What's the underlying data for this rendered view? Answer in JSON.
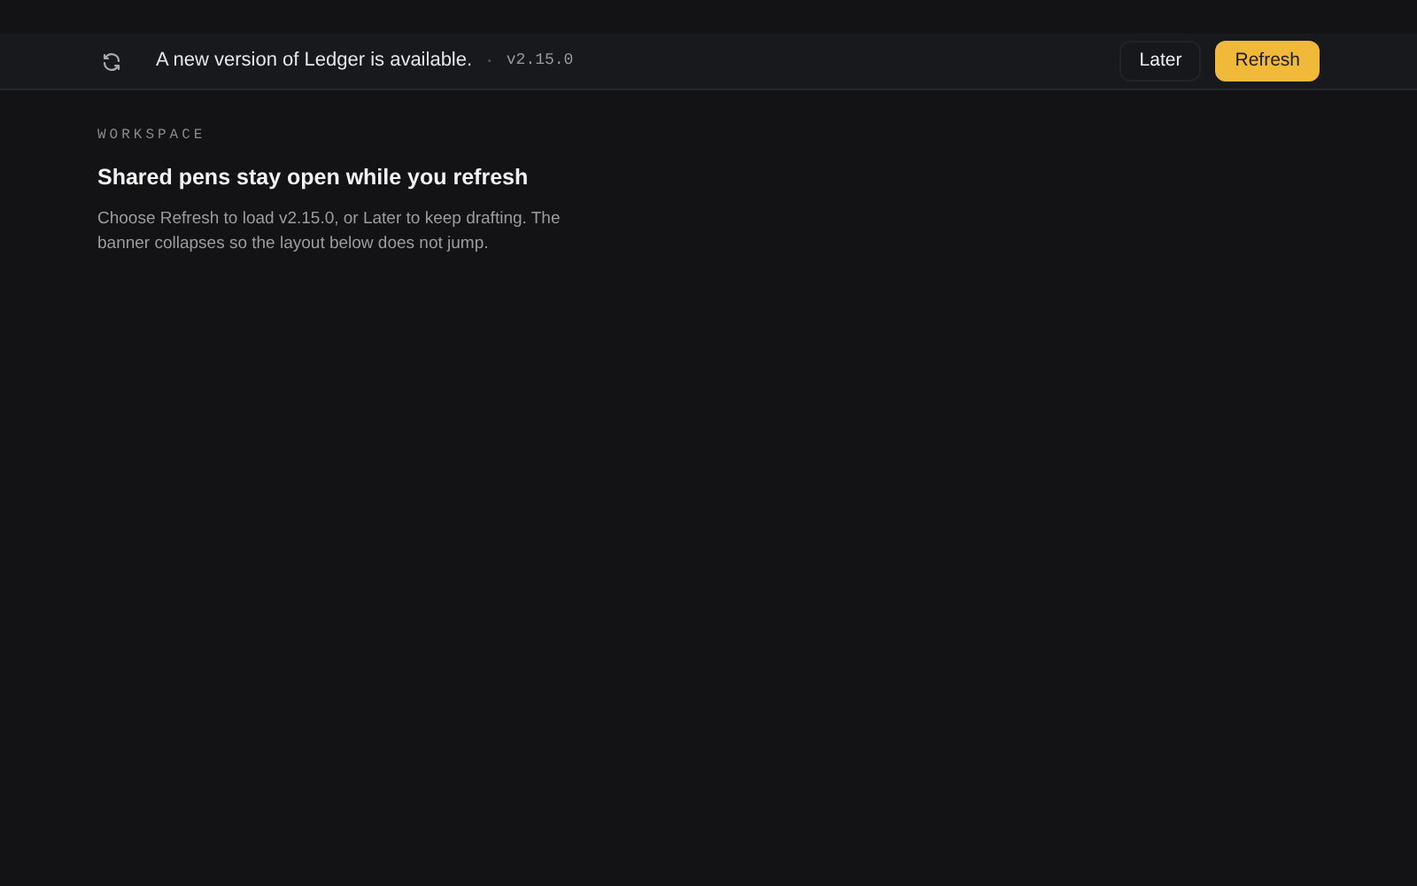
{
  "banner": {
    "message": "A new version of Ledger is available.",
    "separator": "·",
    "version": "v2.15.0",
    "buttons": [
      {
        "label": "Later",
        "kind": "secondary"
      },
      {
        "label": "Refresh",
        "kind": "primary"
      }
    ]
  },
  "section": {
    "eyebrow": "WORKSPACE",
    "title": "Shared pens stay open while you refresh",
    "body": "Choose Refresh to load v2.15.0, or Later to keep drafting. The banner collapses so the layout below does not jump."
  }
}
